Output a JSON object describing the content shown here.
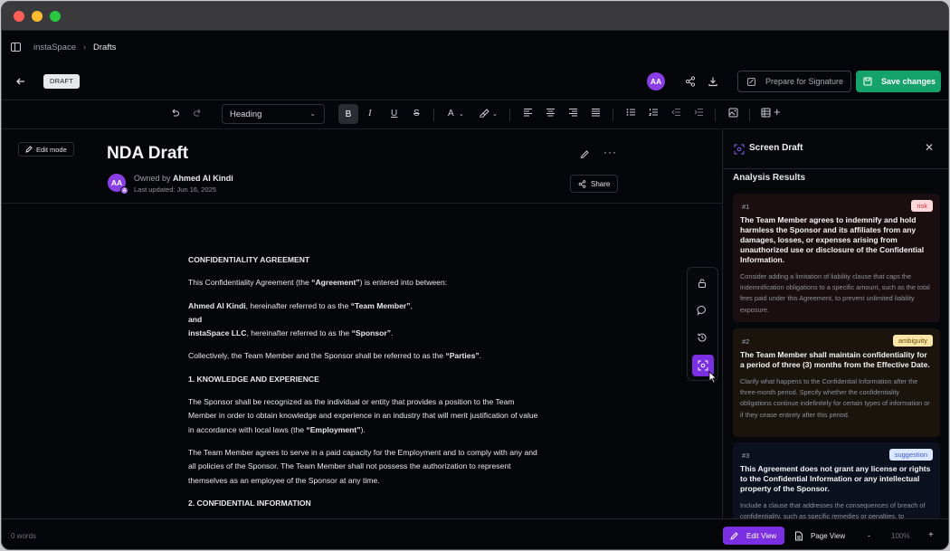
{
  "breadcrumb": {
    "workspace": "instaSpace",
    "separator": "›",
    "current": "Drafts"
  },
  "header": {
    "status_badge": "DRAFT",
    "avatar_initials": "AA",
    "prepare_label": "Prepare for Signature",
    "save_label": "Save changes",
    "colors": {
      "save": "#16a36b",
      "avatar": "#8a3ee6"
    }
  },
  "toolbar": {
    "block_type": "Heading",
    "bold": "B",
    "italic": "I",
    "underline": "U",
    "strike": "S",
    "text_color": "A"
  },
  "document": {
    "edit_mode_label": "Edit mode",
    "title": "NDA Draft",
    "owner_prefix": "Owned by",
    "owner_name": "Ahmed Al Kindi",
    "updated": "Last updated: Jun 16, 2025",
    "share_label": "Share",
    "owner_badge": "A",
    "body": {
      "heading": "CONFIDENTIALITY AGREEMENT",
      "intro_a": "This Confidentiality Agreement (the ",
      "intro_b": "“Agreement”",
      "intro_c": ") is entered into between:",
      "party1_name": "Ahmed Al Kindi",
      "party1_mid": ", hereinafter referred to as the ",
      "party1_role": "“Team Member”",
      "party1_end": ",",
      "and": "and",
      "party2_name": "instaSpace LLC",
      "party2_mid": ", hereinafter referred to as the ",
      "party2_role": "“Sponsor”",
      "party2_end": ".",
      "collective_a": "Collectively, the Team Member and the Sponsor shall be referred to as the ",
      "collective_b": "“Parties”",
      "collective_c": ".",
      "section1": "1. KNOWLEDGE AND EXPERIENCE",
      "s1p1_a": "The Sponsor shall be recognized as the individual or entity that provides a position to the Team Member in order to obtain knowledge and experience in an industry that will merit justification of value in accordance with local laws (the ",
      "s1p1_b": "“Employment”",
      "s1p1_c": ").",
      "s1p2": "The Team Member agrees to serve in a paid capacity for the Employment and to comply with any and all policies of the Sponsor. The Team Member shall not possess the authorization to represent themselves as an employee of the Sponsor at any time.",
      "section2": "2. CONFIDENTIAL INFORMATION"
    }
  },
  "panel": {
    "title": "Screen Draft",
    "section_title": "Analysis Results",
    "results": [
      {
        "num": "#1",
        "tag": "risk",
        "title": "The Team Member agrees to indemnify and hold harmless the Sponsor and its affiliates from any damages, losses, or expenses arising from unauthorized use or disclosure of the Confidential Information.",
        "body": "Consider adding a limitation of liability clause that caps the indemnification obligations to a specific amount, such as the total fees paid under this Agreement, to prevent unlimited liability exposure."
      },
      {
        "num": "#2",
        "tag": "ambiguity",
        "title": "The Team Member shall maintain confidentiality for a period of three (3) months from the Effective Date.",
        "body": "Clarify what happens to the Confidential Information after the three-month period. Specify whether the confidentiality obligations continue indefinitely for certain types of information or if they cease entirely after this period."
      },
      {
        "num": "#3",
        "tag": "suggestion",
        "title": "This Agreement does not grant any license or rights to the Confidential Information or any intellectual property of the Sponsor.",
        "body": "Include a clause that addresses the consequences of breach of confidentiality, such as specific remedies or penalties, to"
      }
    ]
  },
  "status": {
    "word_count": "0 words",
    "edit_view": "Edit View",
    "page_view": "Page View",
    "zoom_minus": "-",
    "zoom": "100%",
    "zoom_plus": "+",
    "accent": "#7a2fe0"
  }
}
